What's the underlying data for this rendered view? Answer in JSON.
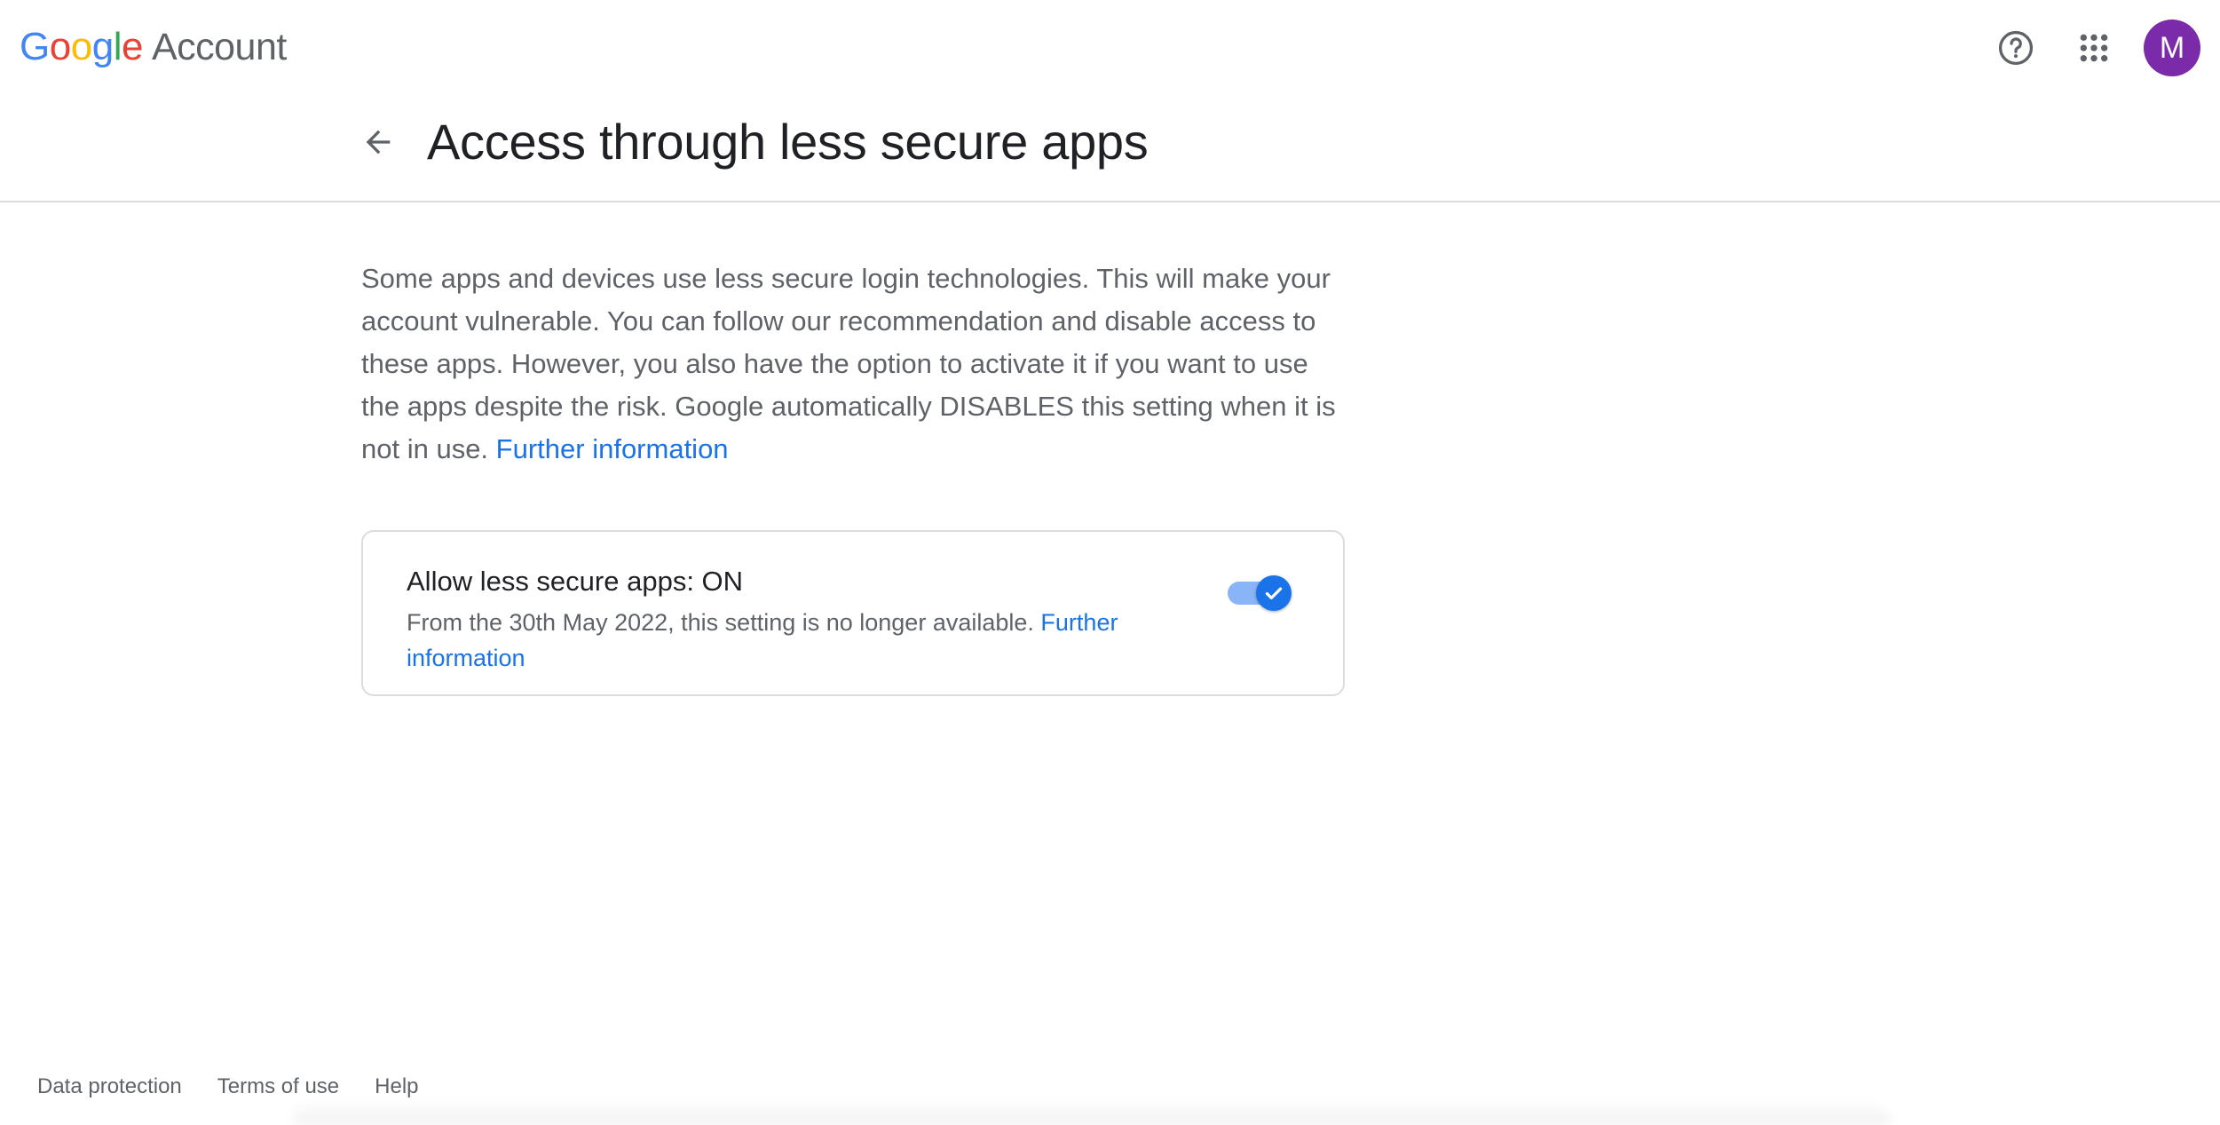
{
  "header": {
    "brand": {
      "google_letters": [
        {
          "char": "G",
          "color": "#4285F4"
        },
        {
          "char": "o",
          "color": "#EA4335"
        },
        {
          "char": "o",
          "color": "#FBBC05"
        },
        {
          "char": "g",
          "color": "#4285F4"
        },
        {
          "char": "l",
          "color": "#34A853"
        },
        {
          "char": "e",
          "color": "#EA4335"
        }
      ],
      "product": "Account"
    },
    "icons": {
      "help": "help-circle-icon",
      "apps": "apps-grid-icon"
    },
    "avatar_initial": "M",
    "avatar_color": "#7B2AA9"
  },
  "page": {
    "back_icon": "arrow-back-icon",
    "title": "Access through less secure apps"
  },
  "content": {
    "intro_text": "Some apps and devices use less secure login technologies. This will make your account vulnerable. You can follow our recommendation and disable access to these apps. However, you also have the option to activate it if you want to use the apps despite the risk. Google automatically DISABLES this setting when it is not in use.",
    "intro_link": "Further information"
  },
  "setting": {
    "title": "Allow less secure apps: ON",
    "description": "From the 30th May 2022, this setting is no longer available.",
    "link": "Further information",
    "toggle_state": true,
    "toggle_icon": "check-icon"
  },
  "footer": {
    "links": [
      "Data protection",
      "Terms of use",
      "Help"
    ]
  },
  "colors": {
    "accent": "#1A73E8",
    "toggle_track": "#8AB4F8",
    "text_primary": "#202124",
    "text_secondary": "#5F6368",
    "divider": "#DADCE0"
  }
}
